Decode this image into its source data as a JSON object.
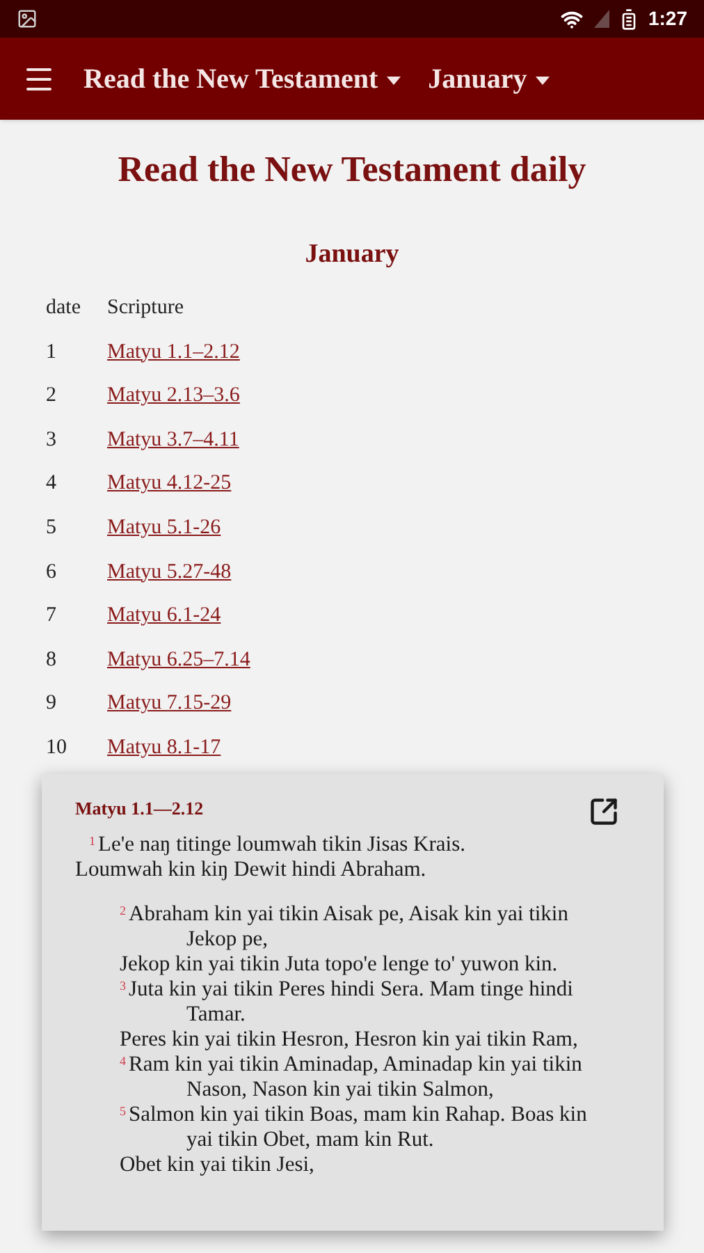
{
  "status_bar": {
    "time": "1:27"
  },
  "app_bar": {
    "book_selector": "Read the New Testament",
    "month_selector": "January"
  },
  "page": {
    "title": "Read the New Testament daily",
    "month_heading": "January",
    "columns": [
      "date",
      "Scripture"
    ],
    "rows": [
      {
        "date": "1",
        "scripture": "Matyu 1.1–2.12"
      },
      {
        "date": "2",
        "scripture": "Matyu 2.13–3.6"
      },
      {
        "date": "3",
        "scripture": "Matyu 3.7–4.11"
      },
      {
        "date": "4",
        "scripture": "Matyu 4.12-25"
      },
      {
        "date": "5",
        "scripture": "Matyu 5.1-26"
      },
      {
        "date": "6",
        "scripture": "Matyu 5.27-48"
      },
      {
        "date": "7",
        "scripture": "Matyu 6.1-24"
      },
      {
        "date": "8",
        "scripture": "Matyu 6.25–7.14"
      },
      {
        "date": "9",
        "scripture": "Matyu 7.15-29"
      },
      {
        "date": "10",
        "scripture": "Matyu 8.1-17"
      }
    ]
  },
  "popup": {
    "reference": "Matyu 1.1—2.12",
    "lines": [
      {
        "kind": "prose_first",
        "verse": "1",
        "text": "Le'e naŋ titinge loumwah tikin Jisas Krais."
      },
      {
        "kind": "prose",
        "text": "Loumwah kin kiŋ Dewit hindi Abraham."
      },
      {
        "kind": "poetry_first",
        "verse": "2",
        "text": "Abraham kin yai tikin Aisak pe, Aisak kin yai tikin Jekop pe,"
      },
      {
        "kind": "poetry",
        "text": "Jekop kin yai tikin Juta topo'e lenge to' yuwon kin."
      },
      {
        "kind": "poetry",
        "verse": "3",
        "text": "Juta kin yai tikin Peres hindi Sera. Mam tinge hindi Tamar."
      },
      {
        "kind": "poetry",
        "text": "Peres kin yai tikin Hesron, Hesron kin yai tikin Ram,"
      },
      {
        "kind": "poetry",
        "verse": "4",
        "text": "Ram kin yai tikin Aminadap, Aminadap kin yai tikin Nason, Nason kin yai tikin Salmon,"
      },
      {
        "kind": "poetry",
        "verse": "5",
        "text": "Salmon kin yai tikin Boas, mam kin Rahap. Boas kin yai tikin Obet, mam kin Rut."
      },
      {
        "kind": "poetry",
        "text": "Obet kin yai tikin Jesi,"
      }
    ]
  }
}
